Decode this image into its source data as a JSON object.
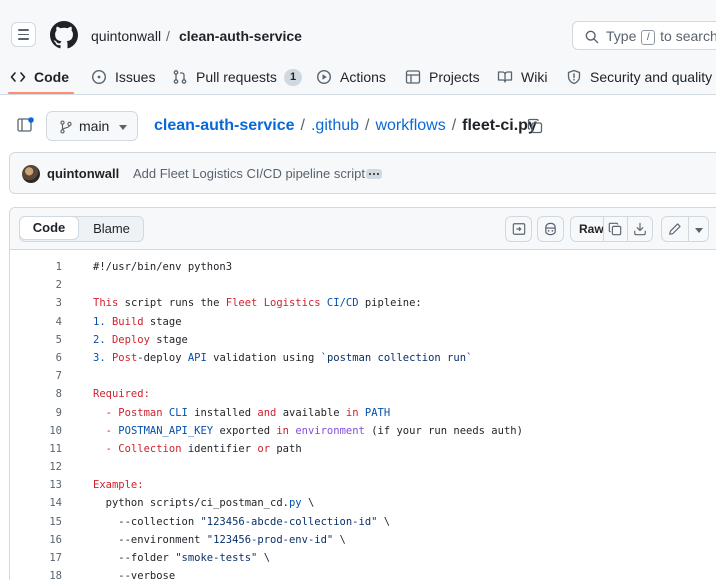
{
  "header": {
    "owner": "quintonwall",
    "separator": "/",
    "repo": "clean-auth-service",
    "search_prefix": "Type",
    "search_key": "/",
    "search_suffix": "to search"
  },
  "nav": {
    "code": "Code",
    "issues": "Issues",
    "pull_requests": "Pull requests",
    "pull_requests_count": "1",
    "actions": "Actions",
    "projects": "Projects",
    "wiki": "Wiki",
    "security": "Security and quality"
  },
  "file_path": {
    "branch": "main",
    "repo": "clean-auth-service",
    "sep": "/",
    "dir1": ".github",
    "dir2": "workflows",
    "file": "fleet-ci.py"
  },
  "commit": {
    "author": "quintonwall",
    "message": "Add Fleet Logistics CI/CD pipeline script"
  },
  "code_header": {
    "code_tab": "Code",
    "blame_tab": "Blame",
    "raw": "Raw"
  },
  "code_lines": [
    {
      "n": "1",
      "tokens": [
        {
          "t": "#!/usr/bin/env python3",
          "c": "k-dark"
        }
      ]
    },
    {
      "n": "2",
      "tokens": []
    },
    {
      "n": "3",
      "tokens": [
        {
          "t": "This",
          "c": "k-red"
        },
        {
          "t": " script runs the ",
          "c": "k-dark"
        },
        {
          "t": "Fleet Logistics",
          "c": "k-red"
        },
        {
          "t": " ",
          "c": "k-dark"
        },
        {
          "t": "CI/CD",
          "c": "k-blue"
        },
        {
          "t": " pipleine:",
          "c": "k-dark"
        }
      ]
    },
    {
      "n": "4",
      "tokens": [
        {
          "t": "1.",
          "c": "k-blue"
        },
        {
          "t": " ",
          "c": "k-dark"
        },
        {
          "t": "Build",
          "c": "k-red"
        },
        {
          "t": " stage",
          "c": "k-dark"
        }
      ]
    },
    {
      "n": "5",
      "tokens": [
        {
          "t": "2.",
          "c": "k-blue"
        },
        {
          "t": " ",
          "c": "k-dark"
        },
        {
          "t": "Deploy",
          "c": "k-red"
        },
        {
          "t": " stage",
          "c": "k-dark"
        }
      ]
    },
    {
      "n": "6",
      "tokens": [
        {
          "t": "3.",
          "c": "k-blue"
        },
        {
          "t": " ",
          "c": "k-dark"
        },
        {
          "t": "Post",
          "c": "k-red"
        },
        {
          "t": "-deploy ",
          "c": "k-dark"
        },
        {
          "t": "API",
          "c": "k-blue"
        },
        {
          "t": " validation using ",
          "c": "k-dark"
        },
        {
          "t": "`postman collection run`",
          "c": "k-navy"
        }
      ]
    },
    {
      "n": "7",
      "tokens": []
    },
    {
      "n": "8",
      "tokens": [
        {
          "t": "Required:",
          "c": "k-red"
        }
      ]
    },
    {
      "n": "9",
      "tokens": [
        {
          "t": "  - ",
          "c": "k-red"
        },
        {
          "t": "Postman",
          "c": "k-red"
        },
        {
          "t": " ",
          "c": "k-dark"
        },
        {
          "t": "CLI",
          "c": "k-blue"
        },
        {
          "t": " installed ",
          "c": "k-dark"
        },
        {
          "t": "and",
          "c": "k-red"
        },
        {
          "t": " available ",
          "c": "k-dark"
        },
        {
          "t": "in",
          "c": "k-red"
        },
        {
          "t": " ",
          "c": "k-dark"
        },
        {
          "t": "PATH",
          "c": "k-blue"
        }
      ]
    },
    {
      "n": "10",
      "tokens": [
        {
          "t": "  - ",
          "c": "k-red"
        },
        {
          "t": "POSTMAN_API_KEY",
          "c": "k-blue"
        },
        {
          "t": " exported ",
          "c": "k-dark"
        },
        {
          "t": "in",
          "c": "k-red"
        },
        {
          "t": " ",
          "c": "k-dark"
        },
        {
          "t": "environment",
          "c": "k-purple"
        },
        {
          "t": " (if your run needs auth)",
          "c": "k-dark"
        }
      ]
    },
    {
      "n": "11",
      "tokens": [
        {
          "t": "  - ",
          "c": "k-red"
        },
        {
          "t": "Collection",
          "c": "k-red"
        },
        {
          "t": " identifier ",
          "c": "k-dark"
        },
        {
          "t": "or",
          "c": "k-red"
        },
        {
          "t": " path",
          "c": "k-dark"
        }
      ]
    },
    {
      "n": "12",
      "tokens": []
    },
    {
      "n": "13",
      "tokens": [
        {
          "t": "Example:",
          "c": "k-red"
        }
      ]
    },
    {
      "n": "14",
      "tokens": [
        {
          "t": "  python scripts/ci_postman_cd.",
          "c": "k-dark"
        },
        {
          "t": "py",
          "c": "k-blue"
        },
        {
          "t": " \\",
          "c": "k-dark"
        }
      ]
    },
    {
      "n": "15",
      "tokens": [
        {
          "t": "    --collection ",
          "c": "k-dark"
        },
        {
          "t": "\"123456-abcde-collection-id\"",
          "c": "k-navy"
        },
        {
          "t": " \\",
          "c": "k-dark"
        }
      ]
    },
    {
      "n": "16",
      "tokens": [
        {
          "t": "    --environment ",
          "c": "k-dark"
        },
        {
          "t": "\"123456-prod-env-id\"",
          "c": "k-navy"
        },
        {
          "t": " \\",
          "c": "k-dark"
        }
      ]
    },
    {
      "n": "17",
      "tokens": [
        {
          "t": "    --folder ",
          "c": "k-dark"
        },
        {
          "t": "\"smoke-tests\"",
          "c": "k-navy"
        },
        {
          "t": " \\",
          "c": "k-dark"
        }
      ]
    },
    {
      "n": "18",
      "tokens": [
        {
          "t": "    --verbose",
          "c": "k-dark"
        }
      ]
    }
  ],
  "colors": {
    "link": "#0969da",
    "nav_underline": "#fd8c73",
    "keyword_red": "#cf222e",
    "string_navy": "#0a3069",
    "constant_blue": "#0550ae",
    "entity_purple": "#8250df"
  },
  "icons": [
    "hamburger-icon",
    "github-logo-icon",
    "search-icon",
    "code-icon",
    "issue-icon",
    "pull-request-icon",
    "play-icon",
    "table-icon",
    "book-icon",
    "shield-icon",
    "file-tree-icon",
    "branch-icon",
    "chevron-down-icon",
    "copy-icon",
    "sidepanel-icon",
    "copilot-icon",
    "download-icon",
    "pencil-icon"
  ]
}
